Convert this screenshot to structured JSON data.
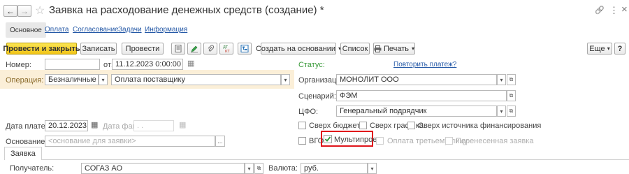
{
  "window": {
    "title": "Заявка на расходование денежных средств (создание) *",
    "back_glyph": "←",
    "forward_glyph": "→",
    "star_glyph": "☆",
    "link_glyph": "🔗",
    "menu_glyph": "⋮",
    "close_glyph": "×"
  },
  "nav_tabs": [
    {
      "label": "Основное"
    },
    {
      "label": "Оплата"
    },
    {
      "label": "Согласование"
    },
    {
      "label": "Задачи"
    },
    {
      "label": "Информация"
    }
  ],
  "toolbar": {
    "post_close": "Провести и закрыть",
    "save": "Записать",
    "post": "Провести",
    "create_based": "Создать на основании",
    "list": "Список",
    "print": "Печать",
    "more": "Еще",
    "help": "?",
    "dropdown_glyph": "▾",
    "icons": [
      "report-icon",
      "edit-green-icon",
      "attach-icon",
      "dt-kt-icon",
      "structure-icon"
    ]
  },
  "form": {
    "number_label": "Номер:",
    "number_value": "",
    "date_label": "от:",
    "date_value": "11.12.2023  0:00:00",
    "operation_label": "Операция:",
    "operation_value": "Безналичные",
    "operation_type": "Оплата поставщику",
    "status_label": "Статус:",
    "status_value": "",
    "repeat_payment": "Повторить платеж?",
    "org_label": "Организация:",
    "org_value": "МОНОЛИТ ООО",
    "scenario_label": "Сценарий:",
    "scenario_value": "ФЭМ",
    "cfo_label": "ЦФО:",
    "cfo_value": "Генеральный подрядчик",
    "pay_date_label": "Дата платежа:",
    "pay_date_value": "20.12.2023",
    "fact_date_label": "Дата факт:",
    "fact_date_value": " .  .",
    "basis_label": "Основание:",
    "basis_placeholder": "<основание для заявки>",
    "over_budget": "Сверх бюджета",
    "over_schedule": "Сверх графика",
    "over_source": "Сверх источника финансирования",
    "vgo": "ВГО",
    "multiproject": "Мультипроект",
    "third_party": "Оплата третьему лицу",
    "transferred": "Перенесенная заявка",
    "calendar_glyph": "▦",
    "ellipsis": "...",
    "open_glyph": "⧉"
  },
  "bottom_tabs": [
    {
      "label": "Заявка"
    }
  ],
  "bottom_row": {
    "recipient_label": "Получатель:",
    "recipient_value": "СОГАЗ АО",
    "currency_label": "Валюта:",
    "currency_value": "руб."
  },
  "colors": {
    "primary_button": "#f6d22f",
    "operation_row_bg": "#fbefd8",
    "highlight_box": "#e0151b",
    "link": "#2458a6",
    "check_green": "#2c9a3a"
  }
}
